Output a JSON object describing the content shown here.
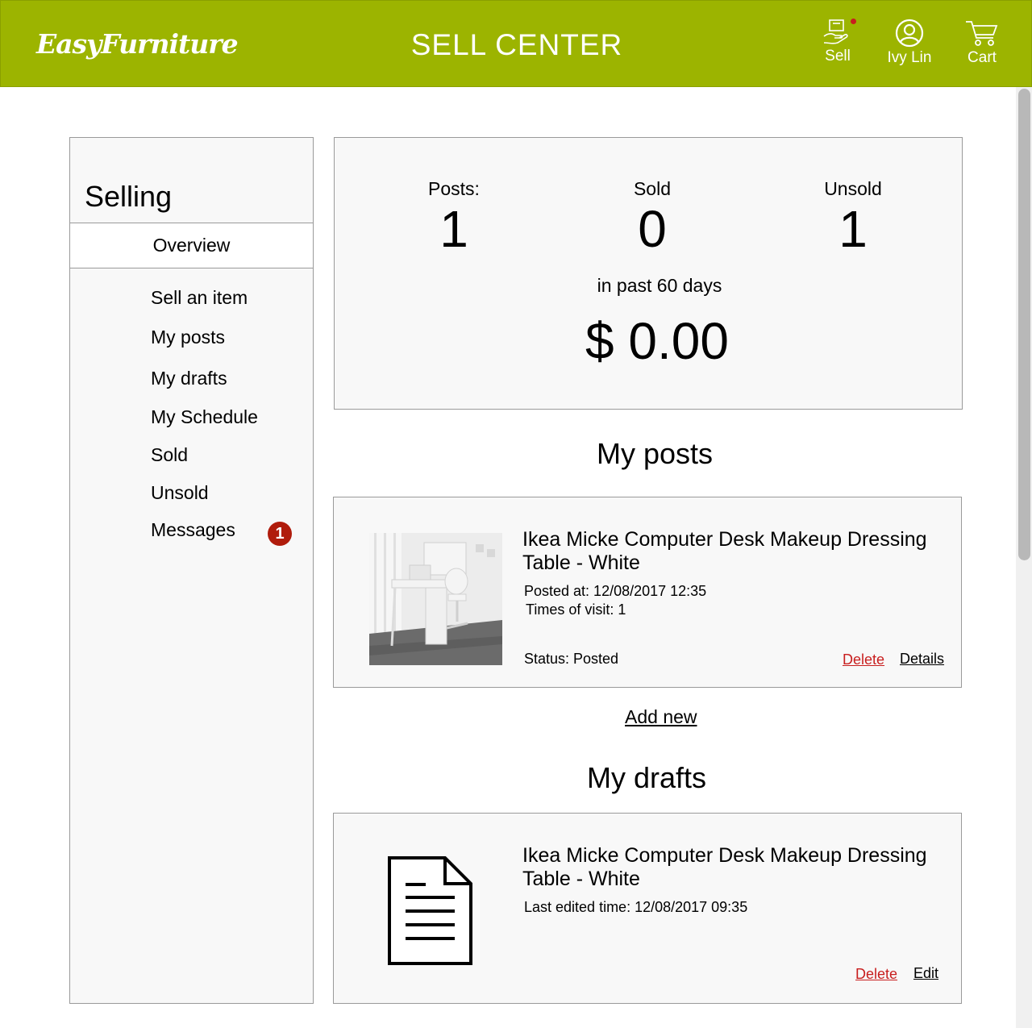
{
  "header": {
    "logo": "EasyFurniture",
    "title": "SELL CENTER",
    "sell_label": "Sell",
    "user_label": "Ivy Lin",
    "cart_label": "Cart",
    "brand_color": "#9cb400"
  },
  "sidebar": {
    "title": "Selling",
    "overview_label": "Overview",
    "items": [
      {
        "label": "Sell an item"
      },
      {
        "label": "My posts"
      },
      {
        "label": "My drafts"
      },
      {
        "label": "My Schedule"
      },
      {
        "label": "Sold"
      },
      {
        "label": "Unsold"
      },
      {
        "label": "Messages"
      }
    ],
    "messages_badge": "1"
  },
  "stats": {
    "posts_label": "Posts:",
    "posts_value": "1",
    "sold_label": "Sold",
    "sold_value": "0",
    "unsold_label": "Unsold",
    "unsold_value": "1",
    "period": "in past 60 days",
    "revenue": "$ 0.00"
  },
  "posts": {
    "section_title": "My posts",
    "item": {
      "title": "Ikea Micke Computer Desk  Makeup Dressing Table - White",
      "posted_at": "Posted at: 12/08/2017 12:35",
      "visits": "Times of visit: 1",
      "status": "Status: Posted",
      "delete_label": "Delete",
      "details_label": "Details"
    },
    "add_new": "Add new"
  },
  "drafts": {
    "section_title": "My drafts",
    "item": {
      "title": "Ikea Micke Computer Desk  Makeup Dressing Table - White",
      "edited": "Last edited time: 12/08/2017 09:35",
      "delete_label": "Delete",
      "edit_label": "Edit"
    }
  }
}
